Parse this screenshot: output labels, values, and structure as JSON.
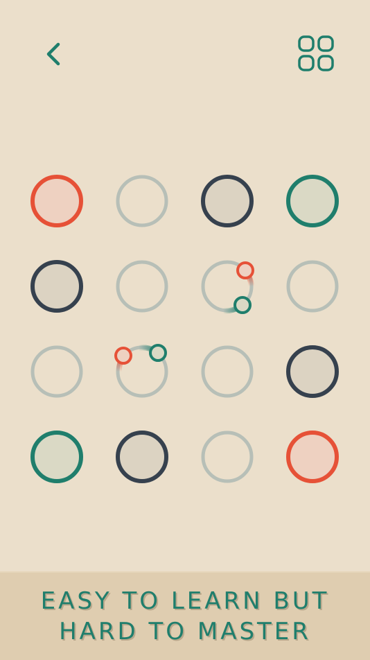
{
  "icons": {
    "back": "chevron-left-icon",
    "menu": "grid-menu-icon"
  },
  "colors": {
    "background": "#ebdfcb",
    "accent": "#1f7e6c",
    "red": "#e65137",
    "dark": "#36414e",
    "empty": "#b7bfb7",
    "banner": "#dfcdb0"
  },
  "board": {
    "rows": 4,
    "cols": 4,
    "cells": [
      "red",
      "empty",
      "dark",
      "teal",
      "dark",
      "empty",
      "dot-pair",
      "empty",
      "empty",
      "dot-pair",
      "empty",
      "dark",
      "teal",
      "dark",
      "empty",
      "red"
    ]
  },
  "banner": {
    "text": "EASY TO LEARN BUT HARD TO MASTER"
  }
}
